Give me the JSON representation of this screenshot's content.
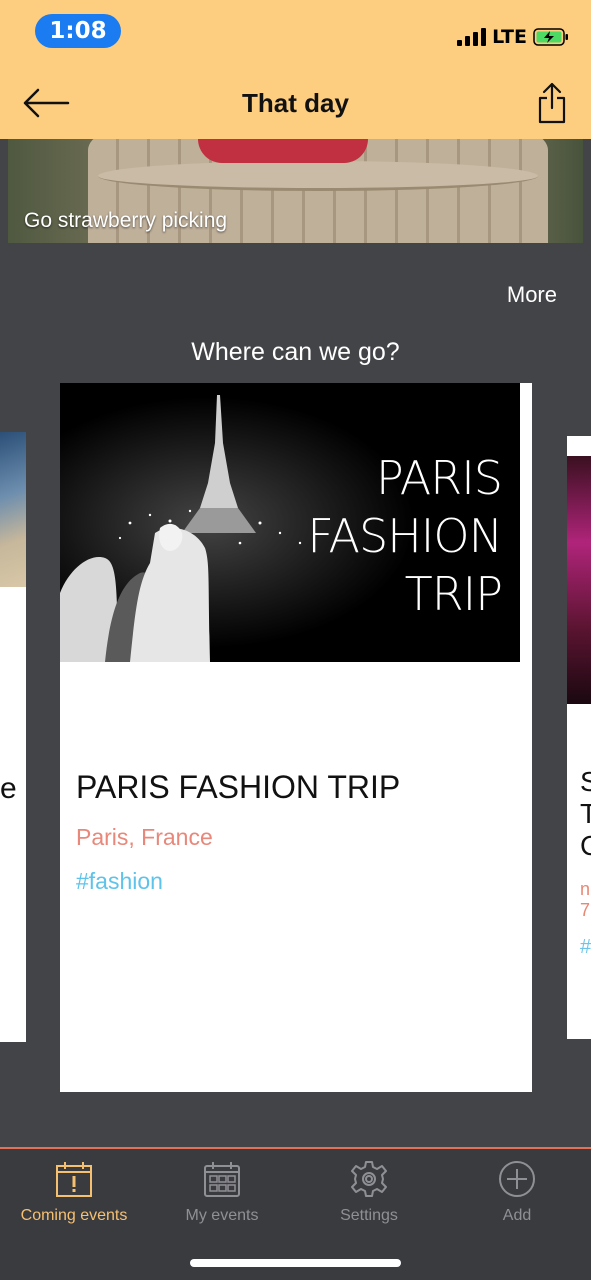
{
  "status_bar": {
    "time": "1:08",
    "network": "LTE"
  },
  "header": {
    "title": "That day",
    "back_icon": "arrow-left-icon",
    "share_icon": "share-icon",
    "background": "#fdcd80"
  },
  "banner": {
    "label": "Go strawberry picking"
  },
  "section": {
    "more": "More",
    "title": "Where can we go?"
  },
  "cards": {
    "main": {
      "image_text": [
        "PARIS",
        "FASHION",
        "TRIP"
      ],
      "title": "PARIS FASHION TRIP",
      "location": "Paris, France",
      "tag": "#fashion"
    },
    "left_peek": {
      "fragment": "e"
    },
    "right_peek": {
      "lines": [
        "S",
        "T",
        "C"
      ],
      "pink_lines": [
        "n",
        "7"
      ],
      "hash": "#"
    }
  },
  "tabbar": {
    "tabs": [
      {
        "label": "Coming events",
        "icon": "calendar-alert-icon",
        "active": true
      },
      {
        "label": "My events",
        "icon": "calendar-grid-icon",
        "active": false
      },
      {
        "label": "Settings",
        "icon": "gear-icon",
        "active": false
      },
      {
        "label": "Add",
        "icon": "plus-circle-icon",
        "active": false
      }
    ]
  },
  "colors": {
    "accent": "#f6c071",
    "location_text": "#e8877a",
    "tag_text": "#5ec3ea",
    "tabbar_border": "#e4705a",
    "background": "#434448"
  }
}
